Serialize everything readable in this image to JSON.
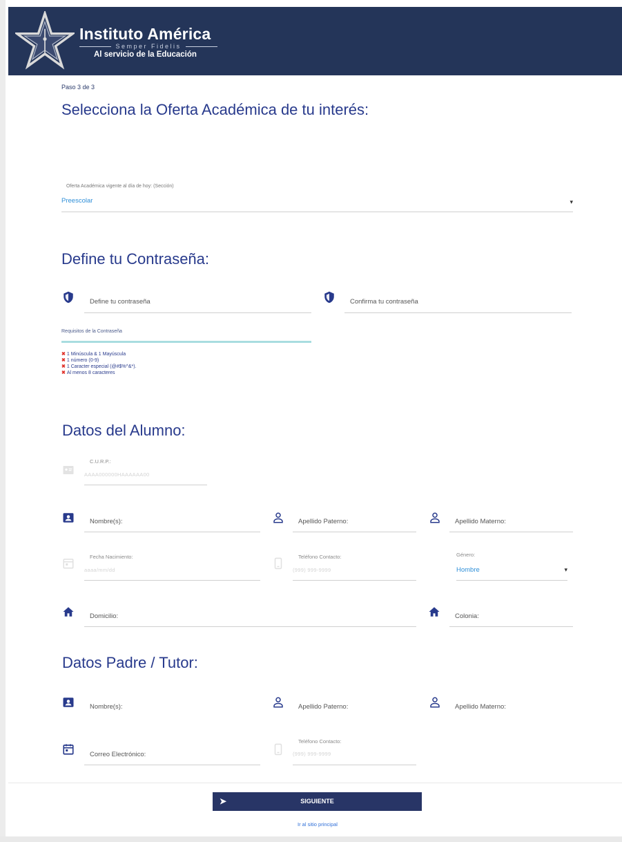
{
  "header": {
    "brand_title": "Instituto América",
    "brand_motto": "Semper Fidelis",
    "brand_subtitle": "Al servicio de la Educación"
  },
  "step": "Paso 3 de 3",
  "oferta": {
    "title": "Selecciona la Oferta Académica de tu interés:",
    "label": "Oferta Académica vigente al día de hoy: (Sección)",
    "value": "Preescolar"
  },
  "password": {
    "title": "Define tu Contraseña:",
    "field1_placeholder": "Define tu contraseña",
    "field2_placeholder": "Confirma tu contraseña",
    "requirements_title": "Requisitos de la Contraseña",
    "requirements": [
      "1 Minúscula & 1 Mayúscula",
      "1 número (0-9)",
      "1 Caracter especial (@#$%^&*).",
      "Al menos 8 caracteres"
    ]
  },
  "alumno": {
    "title": "Datos del Alumno:",
    "curp_label": "C.U.R.P.:",
    "curp_placeholder": "AAAA000000HAAAAAA00",
    "nombre": "Nombre(s):",
    "apellido_paterno": "Apellido Paterno:",
    "apellido_materno": "Apellido Materno:",
    "fecha_label": "Fecha Nacimiento:",
    "fecha_placeholder": "aaaa/mm/dd",
    "telefono_label": "Teléfono Contacto:",
    "telefono_placeholder": "(999) 999-9999",
    "genero_label": "Género:",
    "genero_value": "Hombre",
    "domicilio": "Domicilio:",
    "colonia": "Colonia:"
  },
  "tutor": {
    "title": "Datos Padre / Tutor:",
    "nombre": "Nombre(s):",
    "apellido_paterno": "Apellido Paterno:",
    "apellido_materno": "Apellido Materno:",
    "correo": "Correo Electrónico:",
    "telefono_label": "Teléfono Contacto:",
    "telefono_placeholder": "(999) 999-9999"
  },
  "actions": {
    "next_label": "SIGUIENTE",
    "home_link": "Ir al sitio principal"
  },
  "colors": {
    "header_bg": "#243559",
    "title": "#283a8c",
    "accent_blue": "#2f8fd8",
    "button_bg": "#283566",
    "error_x": "#e0332b"
  }
}
